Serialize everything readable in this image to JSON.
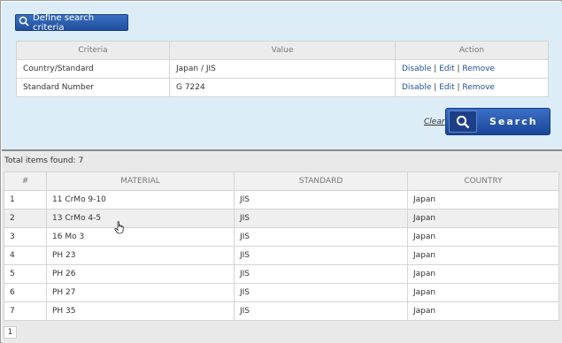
{
  "criteria": {
    "define_button": "Define search criteria",
    "columns": [
      "Criteria",
      "Value",
      "Action"
    ],
    "rows": [
      {
        "criteria": "Country/Standard",
        "value": "Japan / JIS"
      },
      {
        "criteria": "Standard Number",
        "value": "G 7224"
      }
    ],
    "actions": {
      "disable": "Disable",
      "edit": "Edit",
      "remove": "Remove",
      "sep": "|"
    },
    "clear_label": "Clear",
    "search_label": "Search"
  },
  "results": {
    "total_label": "Total items found:",
    "total_count": "7",
    "columns": [
      "#",
      "MATERIAL",
      "STANDARD",
      "COUNTRY"
    ],
    "rows": [
      {
        "n": "1",
        "material": "11 CrMo 9-10",
        "standard": "JIS",
        "country": "Japan"
      },
      {
        "n": "2",
        "material": "13 CrMo 4-5",
        "standard": "JIS",
        "country": "Japan"
      },
      {
        "n": "3",
        "material": "16 Mo 3",
        "standard": "JIS",
        "country": "Japan"
      },
      {
        "n": "4",
        "material": "PH 23",
        "standard": "JIS",
        "country": "Japan"
      },
      {
        "n": "5",
        "material": "PH 26",
        "standard": "JIS",
        "country": "Japan"
      },
      {
        "n": "6",
        "material": "PH 27",
        "standard": "JIS",
        "country": "Japan"
      },
      {
        "n": "7",
        "material": "PH 35",
        "standard": "JIS",
        "country": "Japan"
      }
    ],
    "page": "1"
  },
  "colors": {
    "accent": "#1f4f9c",
    "panel_bg": "#dcedf8",
    "results_bg": "#e9e9e9"
  },
  "icons": {
    "define": "search-icon",
    "search": "search-icon",
    "cursor": "hand-pointer-icon"
  }
}
